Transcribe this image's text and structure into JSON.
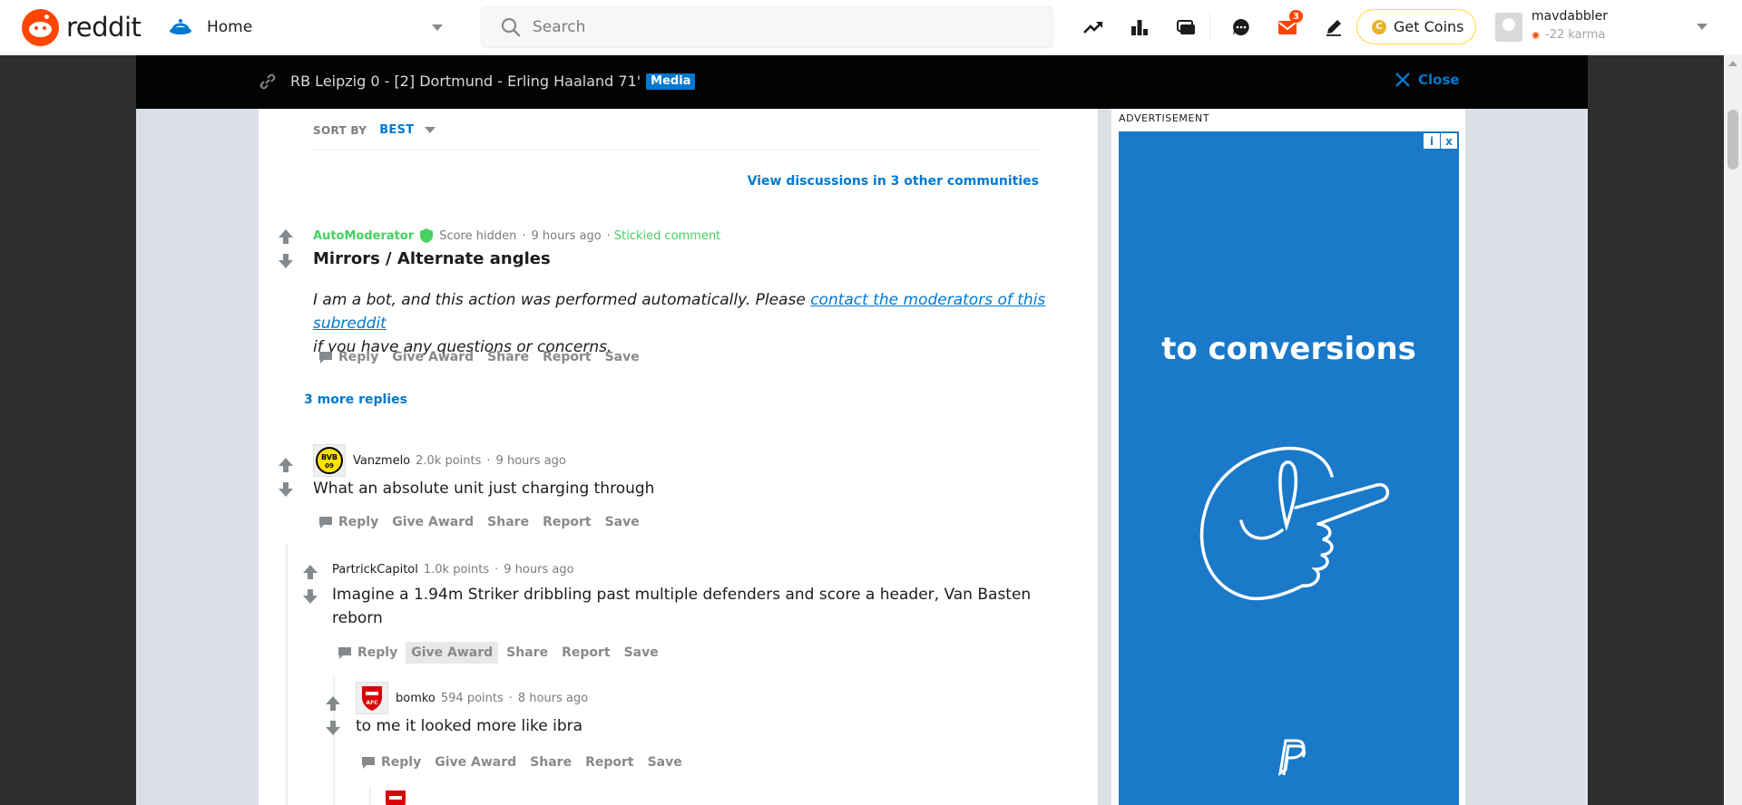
{
  "header": {
    "logo_text": "reddit",
    "home_label": "Home",
    "search_placeholder": "Search",
    "notification_count": "3",
    "get_coins_label": "Get Coins",
    "username": "mavdabbler",
    "karma": "-22 karma"
  },
  "post": {
    "title": "RB Leipzig 0 - [2] Dortmund - Erling Haaland 71'",
    "flair": "Media",
    "close_label": "Close"
  },
  "sort": {
    "label": "SORT BY",
    "value": "BEST"
  },
  "view_discussions": "View discussions in 3 other communities",
  "comments": [
    {
      "author": "AutoModerator",
      "score": "Score hidden",
      "time": "9 hours ago",
      "stickied": "Stickied comment",
      "title": "Mirrors / Alternate angles",
      "body_before": "I am a bot, and this action was performed automatically. Please ",
      "body_link": "contact the moderators of this subreddit",
      "body_after": "if you have any questions or concerns.",
      "more_replies": "3 more replies"
    },
    {
      "author": "Vanzmelo",
      "points": "2.0k points",
      "time": "9 hours ago",
      "body": "What an absolute unit just charging through"
    },
    {
      "author": "PartrickCapitol",
      "points": "1.0k points",
      "time": "9 hours ago",
      "body_line1": "Imagine a 1.94m Striker dribbling past multiple defenders and score a header, Van Basten",
      "body_line2": "reborn"
    },
    {
      "author": "bomko",
      "points": "594 points",
      "time": "8 hours ago",
      "body": "to me it looked more like ibra"
    }
  ],
  "actions": {
    "reply": "Reply",
    "award": "Give Award",
    "share": "Share",
    "report": "Report",
    "save": "Save"
  },
  "ad": {
    "label": "ADVERTISEMENT",
    "headline": "to conversions",
    "info": "i",
    "close": "x"
  },
  "colors": {
    "brand": "#ff4500",
    "link": "#0079d3",
    "mod": "#46d160",
    "ad_bg": "#1a79c9"
  },
  "icons": [
    "reddit-logo-icon",
    "home-icon",
    "search-icon",
    "trending-icon",
    "leaderboard-icon",
    "community-icon",
    "chat-icon",
    "mail-icon",
    "pencil-icon",
    "coin-icon",
    "link-icon",
    "close-icon",
    "upvote-icon",
    "downvote-icon",
    "shield-icon",
    "reply-icon"
  ]
}
